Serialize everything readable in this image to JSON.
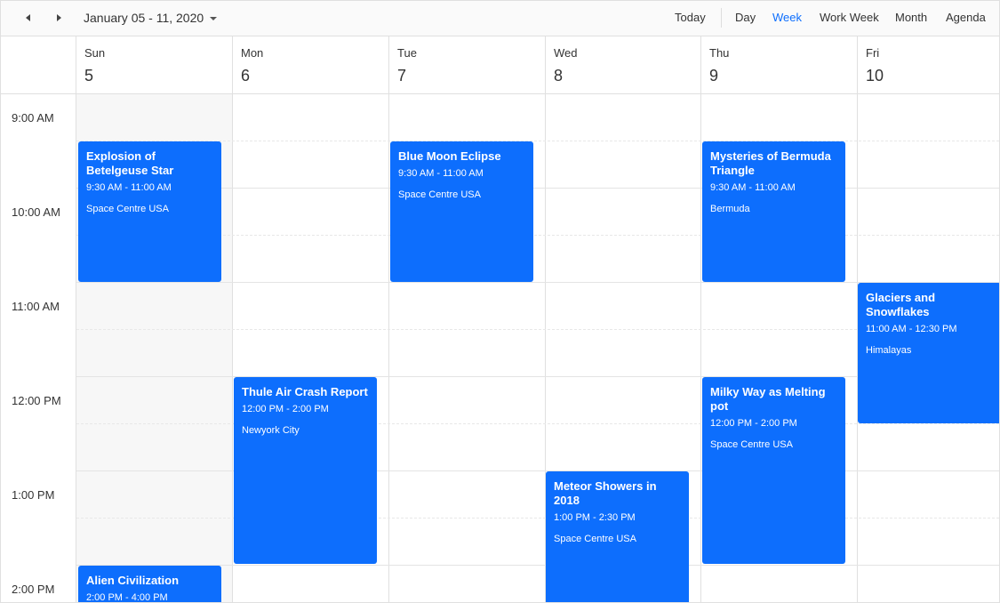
{
  "toolbar": {
    "date_range": "January 05 - 11, 2020",
    "today_label": "Today",
    "views": [
      "Day",
      "Week",
      "Work Week",
      "Month",
      "Agenda"
    ],
    "active_view": "Week",
    "accent_color": "#0d6efd"
  },
  "days": [
    {
      "name": "Sun",
      "num": "5"
    },
    {
      "name": "Mon",
      "num": "6"
    },
    {
      "name": "Tue",
      "num": "7"
    },
    {
      "name": "Wed",
      "num": "8"
    },
    {
      "name": "Thu",
      "num": "9"
    },
    {
      "name": "Fri",
      "num": "10"
    }
  ],
  "time_labels": [
    "9:00 AM",
    "10:00 AM",
    "11:00 AM",
    "12:00 PM",
    "1:00 PM",
    "2:00 PM"
  ],
  "events": [
    {
      "title": "Explosion of Betelgeuse Star",
      "time": "9:30 AM - 11:00 AM",
      "location": "Space Centre USA"
    },
    {
      "title": "Blue Moon Eclipse",
      "time": "9:30 AM - 11:00 AM",
      "location": "Space Centre USA"
    },
    {
      "title": "Mysteries of Bermuda Triangle",
      "time": "9:30 AM - 11:00 AM",
      "location": "Bermuda"
    },
    {
      "title": "Glaciers and Snowflakes",
      "time": "11:00 AM - 12:30 PM",
      "location": "Himalayas"
    },
    {
      "title": "Thule Air Crash Report",
      "time": "12:00 PM - 2:00 PM",
      "location": "Newyork City"
    },
    {
      "title": "Milky Way as Melting pot",
      "time": "12:00 PM - 2:00 PM",
      "location": "Space Centre USA"
    },
    {
      "title": "Meteor Showers in 2018",
      "time": "1:00 PM - 2:30 PM",
      "location": "Space Centre USA"
    },
    {
      "title": "Alien Civilization",
      "time": "2:00 PM - 4:00 PM",
      "location": ""
    }
  ]
}
